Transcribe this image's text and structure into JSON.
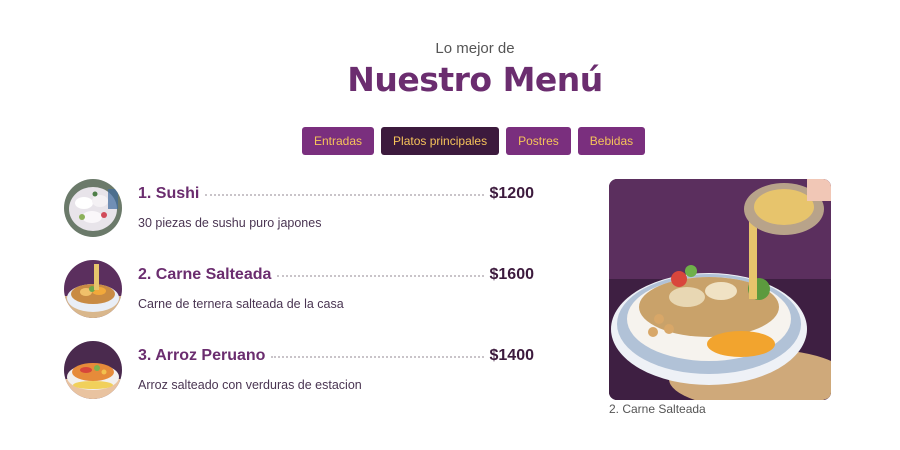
{
  "header": {
    "subtitle": "Lo mejor de",
    "title": "Nuestro Menú"
  },
  "tabs": [
    {
      "label": "Entradas",
      "active": false
    },
    {
      "label": "Platos principales",
      "active": true
    },
    {
      "label": "Postres",
      "active": false
    },
    {
      "label": "Bebidas",
      "active": false
    }
  ],
  "menu": {
    "items": [
      {
        "name": "1. Sushi",
        "price": "$1200",
        "description": "30 piezas de sushu puro japones"
      },
      {
        "name": "2. Carne Salteada",
        "price": "$1600",
        "description": "Carne de ternera salteada de la casa"
      },
      {
        "name": "3. Arroz Peruano",
        "price": "$1400",
        "description": "Arroz salteado con verduras de estacion"
      }
    ]
  },
  "feature": {
    "caption": "2. Carne Salteada"
  },
  "colors": {
    "brand": "#6b2d6f",
    "tab_bg": "#7a2f7e",
    "tab_active_bg": "#3c1a3d",
    "tab_text": "#f6c45a"
  }
}
